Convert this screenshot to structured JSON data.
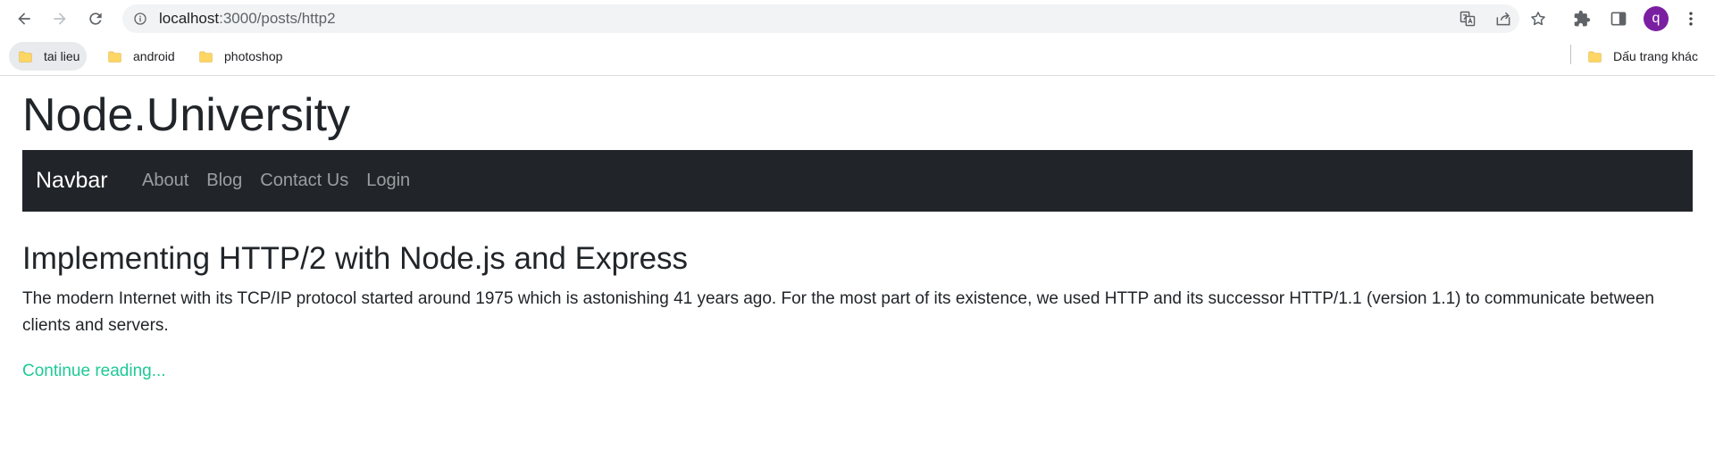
{
  "browser": {
    "url_host": "localhost",
    "url_path": ":3000/posts/http2",
    "icons": {
      "back": "back-arrow-icon",
      "forward": "forward-arrow-icon",
      "reload": "reload-icon",
      "site_info": "info-icon",
      "translate": "translate-icon",
      "share": "share-icon",
      "bookmark": "star-icon",
      "extensions": "puzzle-icon",
      "side_panel": "side-panel-icon",
      "menu": "kebab-menu-icon"
    },
    "profile_initial": "q",
    "profile_color": "#7b1fa2",
    "bookmarks": [
      {
        "label": "tai lieu"
      },
      {
        "label": "android"
      },
      {
        "label": "photoshop"
      }
    ],
    "other_bookmarks": "Dấu trang khác"
  },
  "page": {
    "site_title": "Node.University",
    "navbar": {
      "brand": "Navbar",
      "links": [
        {
          "label": "About"
        },
        {
          "label": "Blog"
        },
        {
          "label": "Contact Us"
        },
        {
          "label": "Login"
        }
      ],
      "background": "#212529"
    },
    "post": {
      "title": "Implementing HTTP/2 with Node.js and Express",
      "excerpt": "The modern Internet with its TCP/IP protocol started around 1975 which is astonishing 41 years ago. For the most part of its existence, we used HTTP and its successor HTTP/1.1 (version 1.1) to communicate between clients and servers.",
      "continue_link": "Continue reading...",
      "link_color": "#20c997"
    }
  }
}
